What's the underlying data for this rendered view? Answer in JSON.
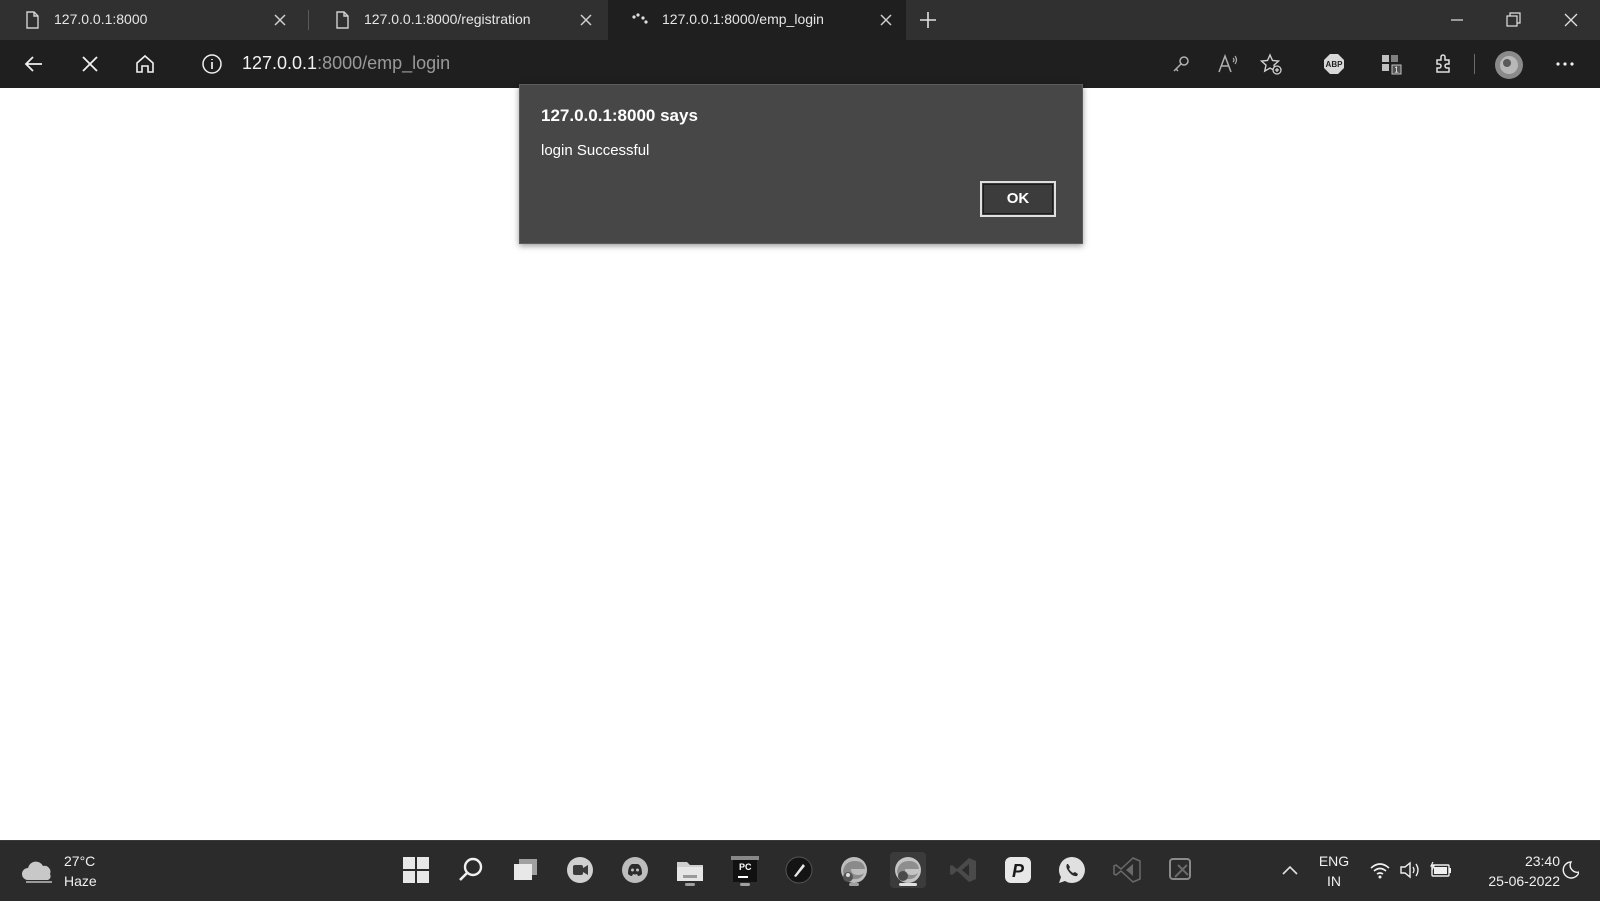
{
  "browser": {
    "tabs": [
      {
        "label": "127.0.0.1:8000"
      },
      {
        "label": "127.0.0.1:8000/registration"
      },
      {
        "label": "127.0.0.1:8000/emp_login"
      }
    ],
    "address_host": "127.0.0.1",
    "address_path": ":8000/emp_login"
  },
  "dialog": {
    "title": "127.0.0.1:8000 says",
    "message": "login Successful",
    "ok_label": "OK"
  },
  "taskbar": {
    "weather_temp": "27°C",
    "weather_desc": "Haze",
    "lang_top": "ENG",
    "lang_bottom": "IN",
    "time": "23:40",
    "date": "25-06-2022"
  },
  "colors": {
    "tab_strip": "#303030",
    "toolbar": "#1f1f1f",
    "dialog": "#474747",
    "taskbar": "#2b2b2b"
  }
}
